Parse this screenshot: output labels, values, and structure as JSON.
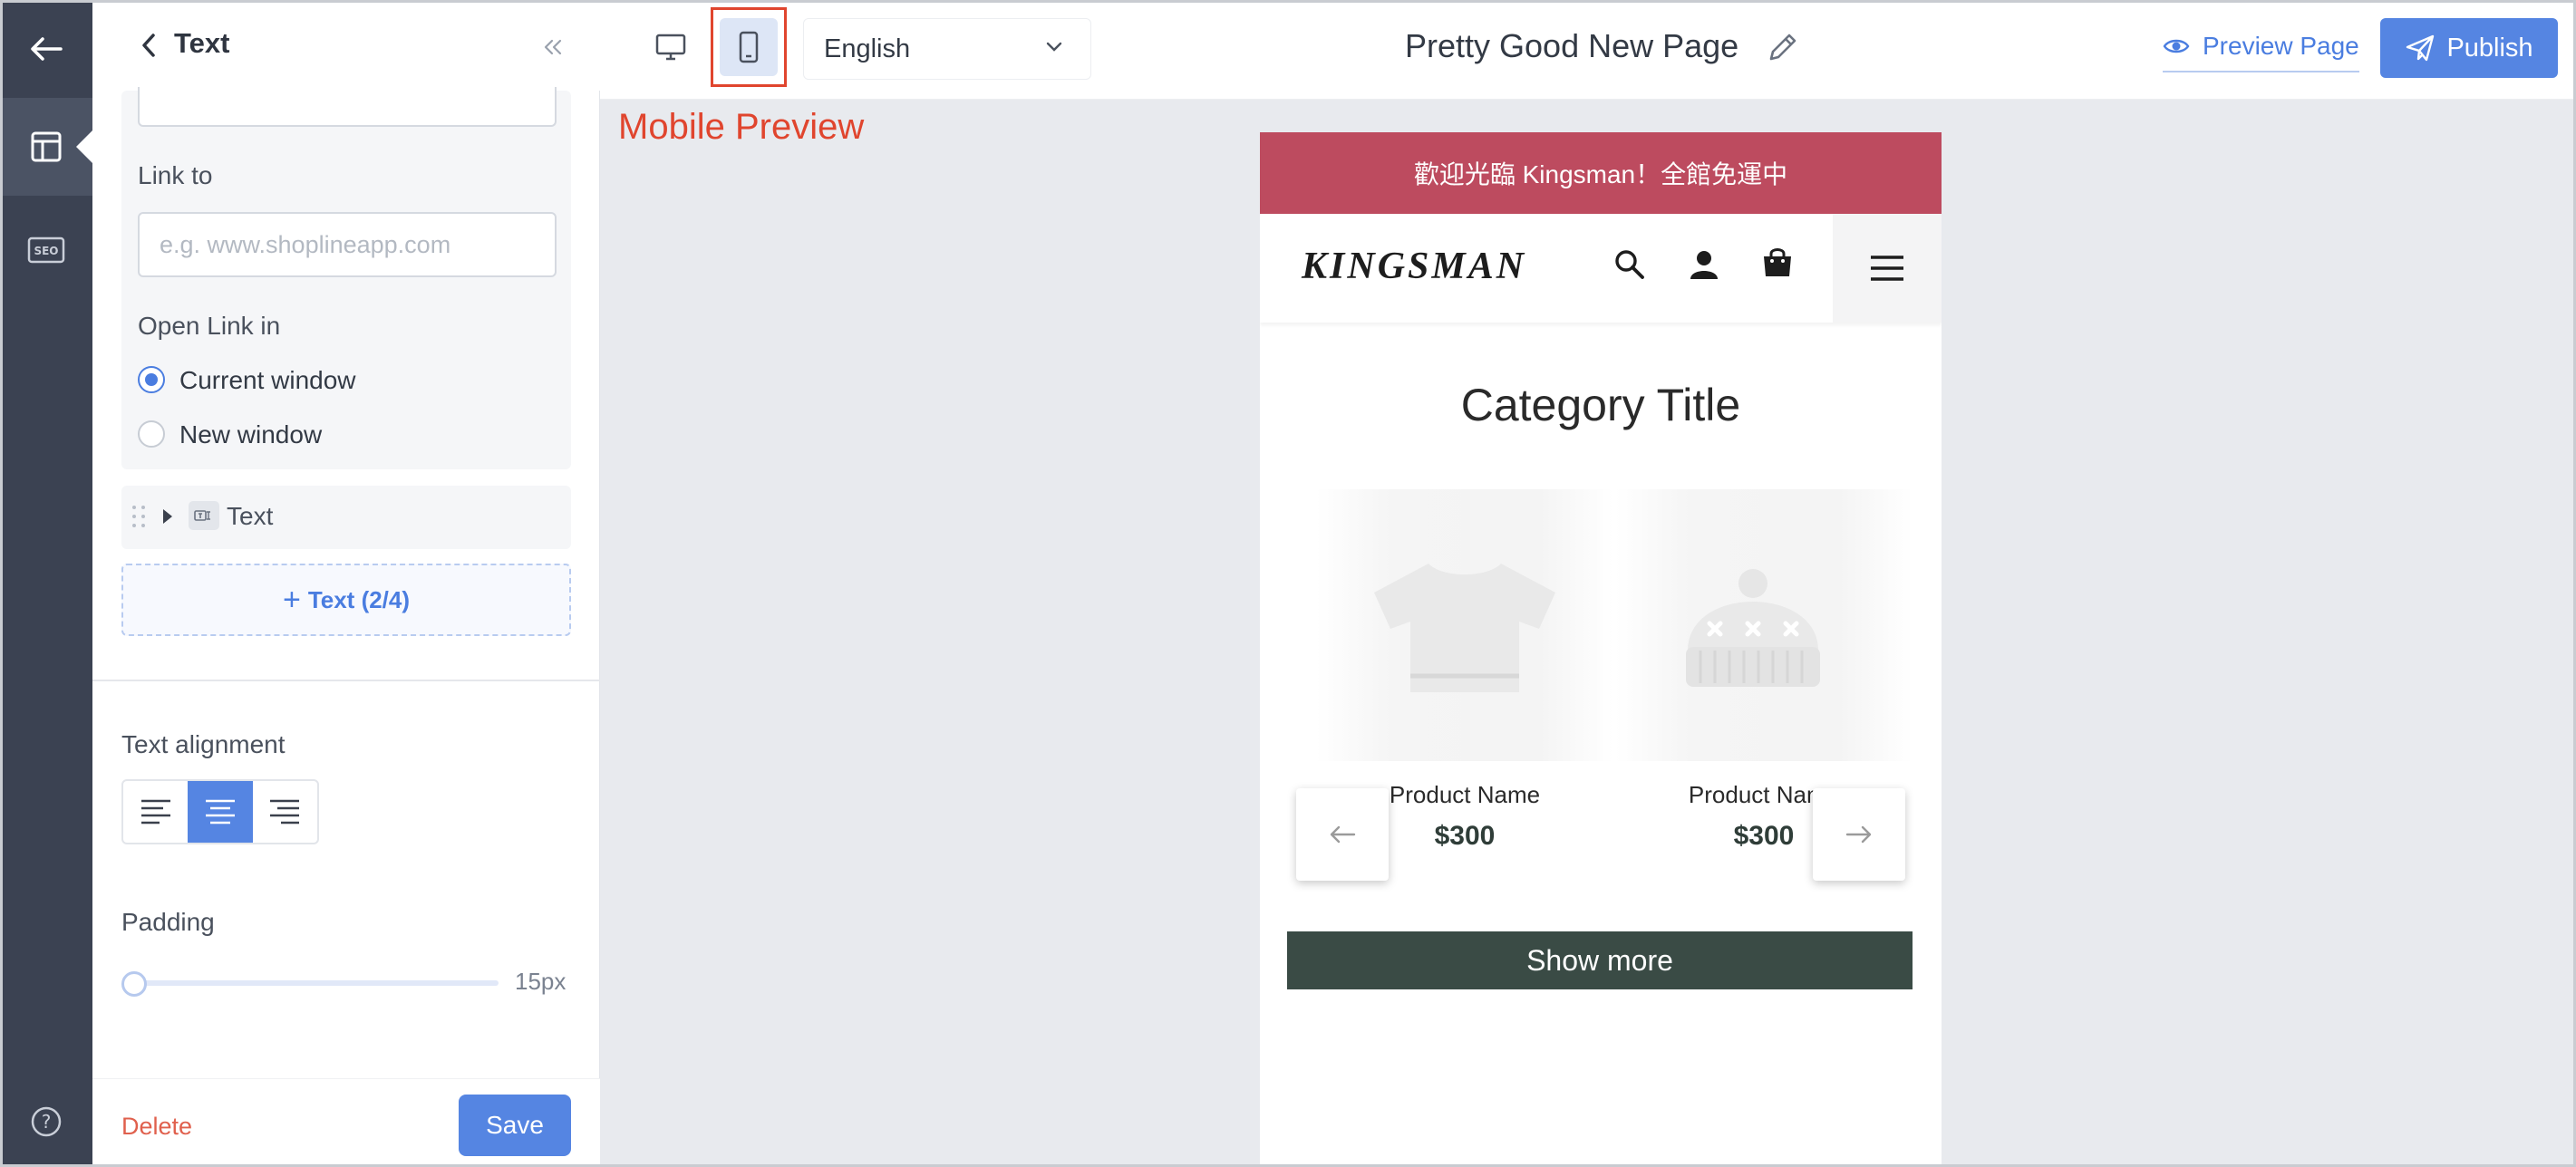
{
  "panel": {
    "title": "Text",
    "link_to_label": "Link to",
    "link_placeholder": "e.g. www.shoplineapp.com",
    "open_link_label": "Open Link in",
    "radio_current": "Current window",
    "radio_new": "New window",
    "selected_window": "current",
    "item_label": "Text",
    "item_chip": "꒕Þ",
    "add_text_label": "Text (2/4)",
    "text_alignment_label": "Text alignment",
    "selected_alignment": "center",
    "padding_label": "Padding",
    "padding_value": "15px",
    "delete_label": "Delete",
    "save_label": "Save"
  },
  "topbar": {
    "language": "English",
    "page_title": "Pretty Good New Page",
    "preview_label": "Preview Page",
    "publish_label": "Publish",
    "active_device": "mobile"
  },
  "canvas": {
    "mobile_preview_label": "Mobile Preview"
  },
  "store": {
    "announcement": "歡迎光臨 Kingsman！全館免運中",
    "logo": "KINGSMAN",
    "category_title": "Category Title",
    "products": [
      {
        "name": "Product Name",
        "price": "$300"
      },
      {
        "name": "Product Name",
        "price": "$300"
      }
    ],
    "show_more": "Show more"
  },
  "colors": {
    "rail": "#3b4252",
    "accent": "#5585e2",
    "announce_bar": "#bd4b5f",
    "show_more_bg": "#3a4b45",
    "highlight": "#e0452e",
    "delete": "#e0604d"
  }
}
